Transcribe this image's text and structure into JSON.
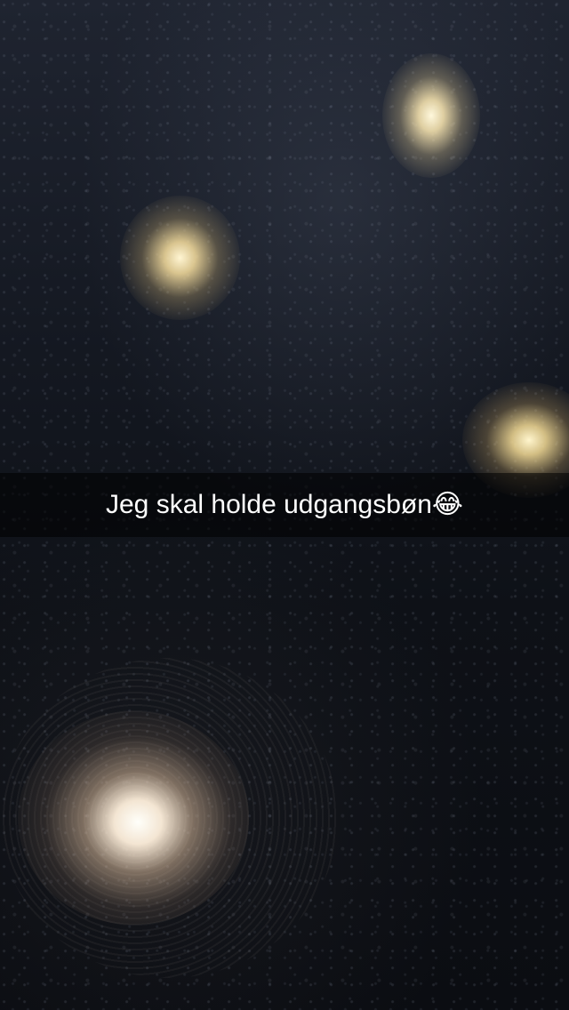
{
  "snap": {
    "caption": "Jeg skal holde udgangsbøn😂"
  }
}
